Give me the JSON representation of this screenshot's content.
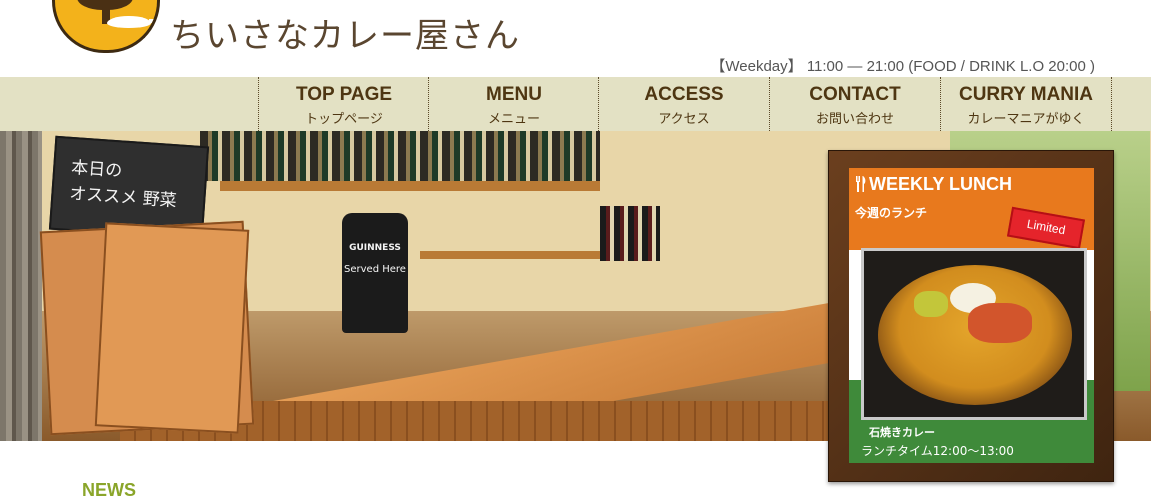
{
  "header": {
    "site_title": "ちいさなカレー屋さん",
    "hours": "【Weekday】 11:00 ― 21:00 (FOOD / DRINK L.O 20:00 )"
  },
  "nav": {
    "items": [
      {
        "en": "TOP PAGE",
        "ja": "トップページ"
      },
      {
        "en": "MENU",
        "ja": "メニュー"
      },
      {
        "en": "ACCESS",
        "ja": "アクセス"
      },
      {
        "en": "CONTACT",
        "ja": "お問い合わせ"
      },
      {
        "en": "CURRY MANIA",
        "ja": "カレーマニアがゆく"
      }
    ]
  },
  "hero": {
    "chalkboard_lines": [
      "本日の",
      "オススメ 野菜"
    ],
    "guinness_label": "GUINNESS",
    "guinness_sub": "Served Here"
  },
  "lunch": {
    "title": "WEEKLY LUNCH",
    "subtitle": "今週のランチ",
    "badge": "Limited",
    "dish": "石焼きカレー",
    "time": "ランチタイム12:00〜13:00"
  },
  "news": {
    "heading": "NEWS"
  },
  "colors": {
    "nav_bg": "#e3e1c4",
    "nav_text": "#4e3612",
    "accent_orange": "#e8791d",
    "accent_green": "#3f8a3a",
    "news_green": "#8aa52a"
  }
}
